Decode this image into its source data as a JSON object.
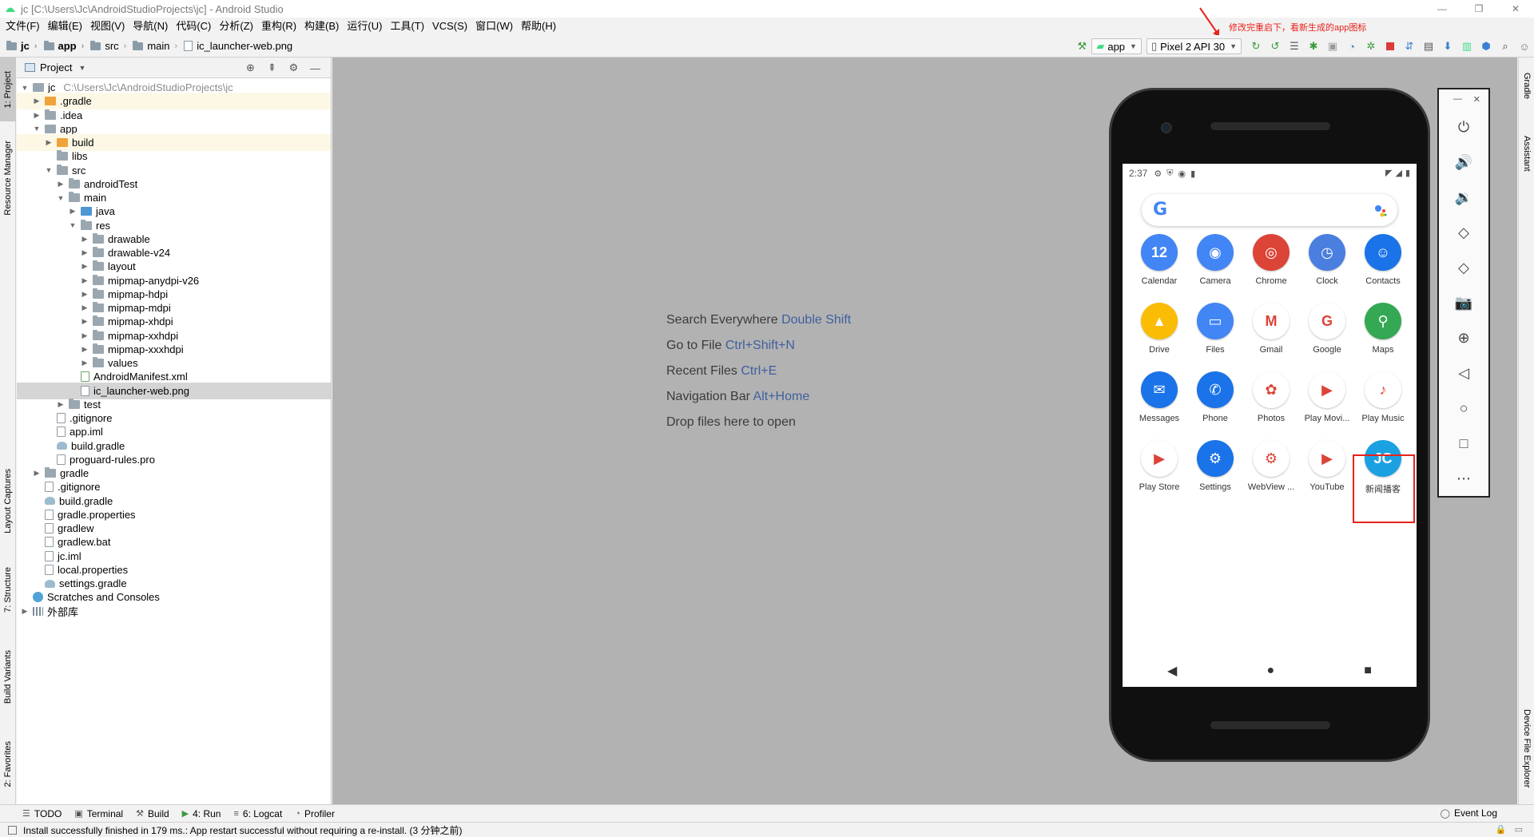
{
  "window": {
    "title": "jc [C:\\Users\\Jc\\AndroidStudioProjects\\jc] - Android Studio",
    "controls": [
      "—",
      "❐",
      "✕"
    ]
  },
  "menu": [
    "文件(F)",
    "编辑(E)",
    "视图(V)",
    "导航(N)",
    "代码(C)",
    "分析(Z)",
    "重构(R)",
    "构建(B)",
    "运行(U)",
    "工具(T)",
    "VCS(S)",
    "窗口(W)",
    "帮助(H)"
  ],
  "annotation": "修改完重启下，看新生成的app图标",
  "breadcrumb": [
    "jc",
    "app",
    "src",
    "main",
    "ic_launcher-web.png"
  ],
  "toolbar": {
    "run_config": "app",
    "device": "Pixel 2 API 30"
  },
  "left_tabs": [
    "1: Project",
    "Resource Manager",
    "Layout Captures",
    "7: Structure",
    "Build Variants",
    "2: Favorites"
  ],
  "right_tabs": [
    "Gradle",
    "Assistant",
    "Device File Explorer"
  ],
  "project_panel": {
    "title": "Project",
    "root_path": "C:\\Users\\Jc\\AndroidStudioProjects\\jc",
    "tree": [
      {
        "label": "jc",
        "depth": 0,
        "arrow": "▼",
        "icon": "modfolder",
        "path": true
      },
      {
        "label": ".gradle",
        "depth": 1,
        "arrow": "▶",
        "icon": "orange",
        "hl": true
      },
      {
        "label": ".idea",
        "depth": 1,
        "arrow": "▶",
        "icon": "folder"
      },
      {
        "label": "app",
        "depth": 1,
        "arrow": "▼",
        "icon": "modfolder"
      },
      {
        "label": "build",
        "depth": 2,
        "arrow": "▶",
        "icon": "orange",
        "hl": true
      },
      {
        "label": "libs",
        "depth": 2,
        "arrow": "",
        "icon": "folder"
      },
      {
        "label": "src",
        "depth": 2,
        "arrow": "▼",
        "icon": "folder"
      },
      {
        "label": "androidTest",
        "depth": 3,
        "arrow": "▶",
        "icon": "folder"
      },
      {
        "label": "main",
        "depth": 3,
        "arrow": "▼",
        "icon": "folder"
      },
      {
        "label": "java",
        "depth": 4,
        "arrow": "▶",
        "icon": "blue"
      },
      {
        "label": "res",
        "depth": 4,
        "arrow": "▼",
        "icon": "folder"
      },
      {
        "label": "drawable",
        "depth": 5,
        "arrow": "▶",
        "icon": "folder"
      },
      {
        "label": "drawable-v24",
        "depth": 5,
        "arrow": "▶",
        "icon": "folder"
      },
      {
        "label": "layout",
        "depth": 5,
        "arrow": "▶",
        "icon": "folder"
      },
      {
        "label": "mipmap-anydpi-v26",
        "depth": 5,
        "arrow": "▶",
        "icon": "folder"
      },
      {
        "label": "mipmap-hdpi",
        "depth": 5,
        "arrow": "▶",
        "icon": "folder"
      },
      {
        "label": "mipmap-mdpi",
        "depth": 5,
        "arrow": "▶",
        "icon": "folder"
      },
      {
        "label": "mipmap-xhdpi",
        "depth": 5,
        "arrow": "▶",
        "icon": "folder"
      },
      {
        "label": "mipmap-xxhdpi",
        "depth": 5,
        "arrow": "▶",
        "icon": "folder"
      },
      {
        "label": "mipmap-xxxhdpi",
        "depth": 5,
        "arrow": "▶",
        "icon": "folder"
      },
      {
        "label": "values",
        "depth": 5,
        "arrow": "▶",
        "icon": "folder"
      },
      {
        "label": "AndroidManifest.xml",
        "depth": 4,
        "arrow": "",
        "icon": "xml"
      },
      {
        "label": "ic_launcher-web.png",
        "depth": 4,
        "arrow": "",
        "icon": "file",
        "sel": true
      },
      {
        "label": "test",
        "depth": 3,
        "arrow": "▶",
        "icon": "folder"
      },
      {
        "label": ".gitignore",
        "depth": 2,
        "arrow": "",
        "icon": "file"
      },
      {
        "label": "app.iml",
        "depth": 2,
        "arrow": "",
        "icon": "file"
      },
      {
        "label": "build.gradle",
        "depth": 2,
        "arrow": "",
        "icon": "gradle"
      },
      {
        "label": "proguard-rules.pro",
        "depth": 2,
        "arrow": "",
        "icon": "file"
      },
      {
        "label": "gradle",
        "depth": 1,
        "arrow": "▶",
        "icon": "folder"
      },
      {
        "label": ".gitignore",
        "depth": 1,
        "arrow": "",
        "icon": "file"
      },
      {
        "label": "build.gradle",
        "depth": 1,
        "arrow": "",
        "icon": "gradle"
      },
      {
        "label": "gradle.properties",
        "depth": 1,
        "arrow": "",
        "icon": "file"
      },
      {
        "label": "gradlew",
        "depth": 1,
        "arrow": "",
        "icon": "file"
      },
      {
        "label": "gradlew.bat",
        "depth": 1,
        "arrow": "",
        "icon": "file"
      },
      {
        "label": "jc.iml",
        "depth": 1,
        "arrow": "",
        "icon": "file"
      },
      {
        "label": "local.properties",
        "depth": 1,
        "arrow": "",
        "icon": "file"
      },
      {
        "label": "settings.gradle",
        "depth": 1,
        "arrow": "",
        "icon": "gradle"
      },
      {
        "label": "Scratches and Consoles",
        "depth": 0,
        "arrow": "",
        "icon": "scratch"
      },
      {
        "label": "外部库",
        "depth": 0,
        "arrow": "▶",
        "icon": "lib"
      }
    ]
  },
  "editor_hints": [
    {
      "text": "Search Everywhere",
      "key": "Double Shift"
    },
    {
      "text": "Go to File",
      "key": "Ctrl+Shift+N"
    },
    {
      "text": "Recent Files",
      "key": "Ctrl+E"
    },
    {
      "text": "Navigation Bar",
      "key": "Alt+Home"
    },
    {
      "text": "Drop files here to open",
      "key": ""
    }
  ],
  "emulator": {
    "time": "2:37",
    "calendar_day": "12",
    "apps": [
      {
        "label": "Calendar",
        "color": "#4285f4",
        "glyph": "12"
      },
      {
        "label": "Camera",
        "color": "#4285f4",
        "glyph": "◉"
      },
      {
        "label": "Chrome",
        "color": "#db4437",
        "glyph": "◎"
      },
      {
        "label": "Clock",
        "color": "#4a7fe0",
        "glyph": "◷"
      },
      {
        "label": "Contacts",
        "color": "#1a73e8",
        "glyph": "☺"
      },
      {
        "label": "Drive",
        "color": "#fbbc05",
        "glyph": "▲"
      },
      {
        "label": "Files",
        "color": "#4285f4",
        "glyph": "▭"
      },
      {
        "label": "Gmail",
        "color": "#ffffff",
        "glyph": "M"
      },
      {
        "label": "Google",
        "color": "#ffffff",
        "glyph": "G"
      },
      {
        "label": "Maps",
        "color": "#34a853",
        "glyph": "⚲"
      },
      {
        "label": "Messages",
        "color": "#1a73e8",
        "glyph": "✉"
      },
      {
        "label": "Phone",
        "color": "#1a73e8",
        "glyph": "✆"
      },
      {
        "label": "Photos",
        "color": "#ffffff",
        "glyph": "✿"
      },
      {
        "label": "Play Movi...",
        "color": "#ffffff",
        "glyph": "▶"
      },
      {
        "label": "Play Music",
        "color": "#ffffff",
        "glyph": "♪"
      },
      {
        "label": "Play Store",
        "color": "#ffffff",
        "glyph": "▶"
      },
      {
        "label": "Settings",
        "color": "#1a73e8",
        "glyph": "⚙"
      },
      {
        "label": "WebView ...",
        "color": "#ffffff",
        "glyph": "⚙"
      },
      {
        "label": "YouTube",
        "color": "#ffffff",
        "glyph": "▶"
      },
      {
        "label": "新闻播客",
        "color": "#1ba1e2",
        "glyph": "JC"
      }
    ],
    "side_controls": [
      "⏻",
      "🔊",
      "🔉",
      "◇",
      "◇",
      "📷",
      "⊕",
      "◁",
      "○",
      "□",
      "⋯"
    ],
    "nav": [
      "◀",
      "●",
      "■"
    ]
  },
  "bottom_tabs": [
    "TODO",
    "Terminal",
    "Build",
    "4: Run",
    "6: Logcat",
    "Profiler"
  ],
  "event_log": "Event Log",
  "status_message": "Install successfully finished in 179 ms.: App restart successful without requiring a re-install. (3 分钟之前)",
  "colors": {
    "annotation": "#e8221c",
    "shortcut": "#3f5f9f",
    "editor_bg": "#b2b2b2"
  }
}
